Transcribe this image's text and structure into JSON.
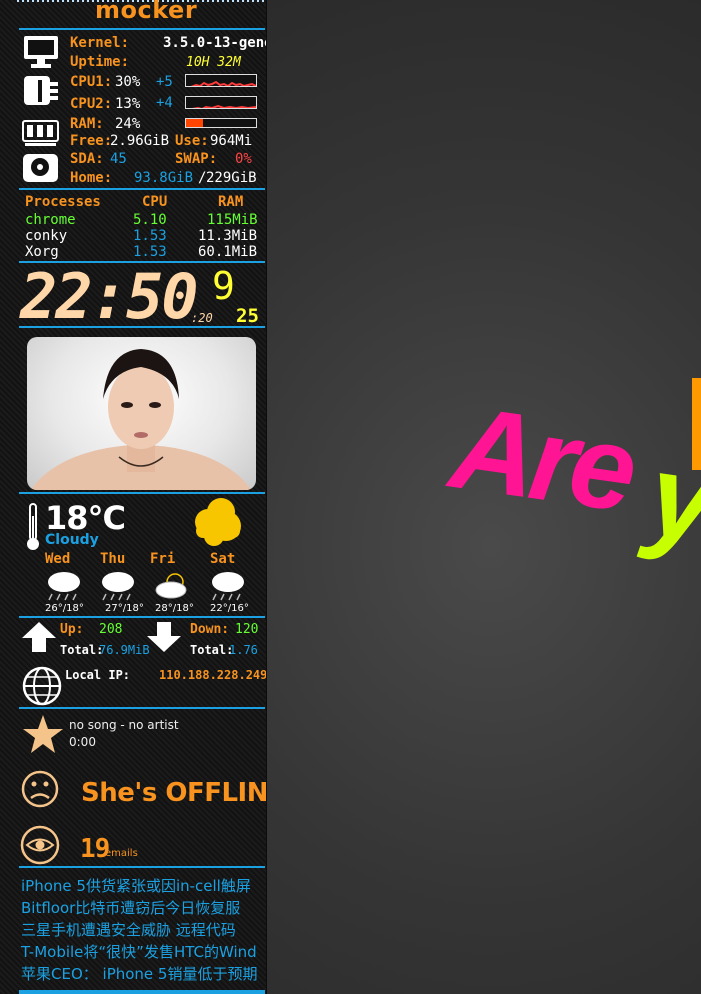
{
  "header": {
    "hostname": "mocker"
  },
  "system": {
    "kernel_label": "Kernel:",
    "kernel_value": "3.5.0-13-gene",
    "uptime_label": "Uptime:",
    "uptime_value": "10H 32M",
    "cpu1_label": "CPU1:",
    "cpu1_value": "30%",
    "cpu1_temp": "+5",
    "cpu2_label": "CPU2:",
    "cpu2_value": "13%",
    "cpu2_temp": "+4",
    "ram_label": "RAM:",
    "ram_value": "24%",
    "ram_fraction": 0.24,
    "free_label": "Free:",
    "free_value": "2.96GiB",
    "use_label": "Use:",
    "use_value": "964Mi",
    "sda_label": "SDA:",
    "sda_value": "45",
    "swap_label": "SWAP:",
    "swap_value": "0%",
    "home_label": "Home:",
    "home_used": "93.8GiB",
    "home_slash": "/",
    "home_total": "229GiB"
  },
  "processes": {
    "headers": [
      "Processes",
      "CPU",
      "RAM"
    ],
    "rows": [
      {
        "name": "chrome",
        "cpu": "5.10",
        "ram": "115MiB"
      },
      {
        "name": "conky",
        "cpu": "1.53",
        "ram": "11.3MiB"
      },
      {
        "name": "Xorg",
        "cpu": "1.53",
        "ram": "60.1MiB"
      }
    ]
  },
  "clock": {
    "time": "22:50",
    "seconds": ":20",
    "month": "9",
    "day": "25"
  },
  "weather": {
    "temp": "18°C",
    "condition": "Cloudy",
    "forecast": [
      {
        "day": "Wed",
        "temps": "26°/18°",
        "icon": "rain-cloud-icon"
      },
      {
        "day": "Thu",
        "temps": "27°/18°",
        "icon": "rain-cloud-icon"
      },
      {
        "day": "Fri",
        "temps": "28°/18°",
        "icon": "partly-sunny-icon"
      },
      {
        "day": "Sat",
        "temps": "22°/16°",
        "icon": "rain-cloud-icon"
      }
    ]
  },
  "network": {
    "up_label": "Up:",
    "up_value": "208",
    "down_label": "Down:",
    "down_value": "120",
    "total_label": "Total:",
    "up_total": "76.9MiB",
    "down_total": "1.76",
    "ip_label": "Local IP:",
    "ip_value": "110.188.228.249"
  },
  "music": {
    "song": "no song - no artist",
    "time": "0:00"
  },
  "status": {
    "text": "She's OFFLINE"
  },
  "email": {
    "count": "19",
    "label": "emails"
  },
  "news": [
    "iPhone 5供货紧张或因in-cell触屏",
    "Bitfloor比特币遭窃后今日恢复服",
    "三星手机遭遇安全威胁 远程代码",
    "T-Mobile将“很快”发售HTC的Wind",
    "苹果CEO： iPhone 5销量低于预期"
  ],
  "wallpaper": {
    "word1": "Are",
    "word2": "y"
  },
  "colors": {
    "accent": "#f7931e",
    "blue": "#1ba1e2",
    "green": "#66ff33",
    "yellow": "#ffff33",
    "pink": "#ff1493",
    "lime": "#c8ff00"
  }
}
